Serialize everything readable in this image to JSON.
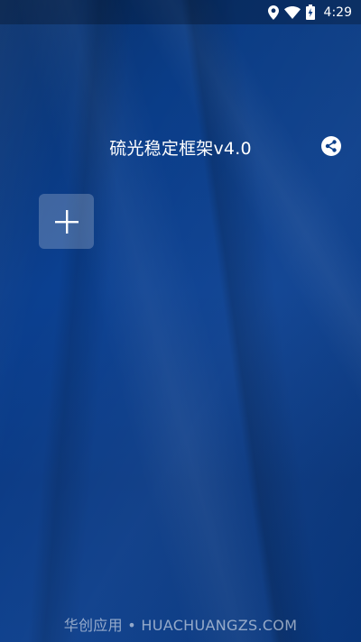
{
  "status_bar": {
    "time": "4:29",
    "icons": [
      "location-icon",
      "wifi-icon",
      "battery-charging-icon"
    ]
  },
  "header": {
    "title": "硫光稳定框架v4.0",
    "share_icon": "share-icon"
  },
  "main": {
    "add_icon": "plus-icon"
  },
  "footer": {
    "watermark": "华创应用 • HUACHUANGZS.COM"
  },
  "colors": {
    "background": "#0b3f8a",
    "add_button_bg": "rgba(255,255,255,0.22)"
  }
}
